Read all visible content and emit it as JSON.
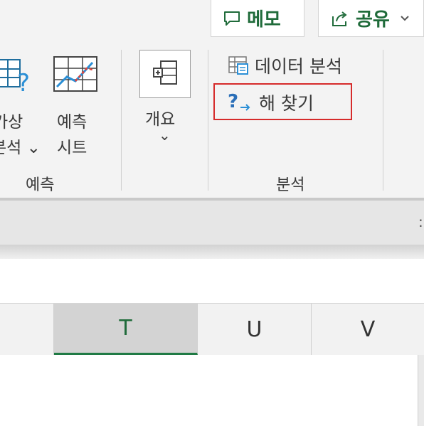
{
  "top_buttons": {
    "memo_label": "메모",
    "share_label": "공유"
  },
  "ribbon": {
    "forecast_group": {
      "what_if_line1": "가상",
      "what_if_line2": "분석 ⌄",
      "forecast_sheet_line1": "예측",
      "forecast_sheet_line2": "시트",
      "group_label": "예측"
    },
    "outline_group": {
      "outline_label": "개요",
      "dropdown_chevron": "⌄"
    },
    "analysis_group": {
      "data_analysis_label": "데이터 분석",
      "solver_label": "해 찾기",
      "group_label": "분석"
    }
  },
  "grid": {
    "columns": [
      "T",
      "U",
      "V"
    ],
    "selected_column": "T"
  },
  "colors": {
    "accent_green": "#1f6b3a",
    "highlight_red": "#d62b2b"
  }
}
